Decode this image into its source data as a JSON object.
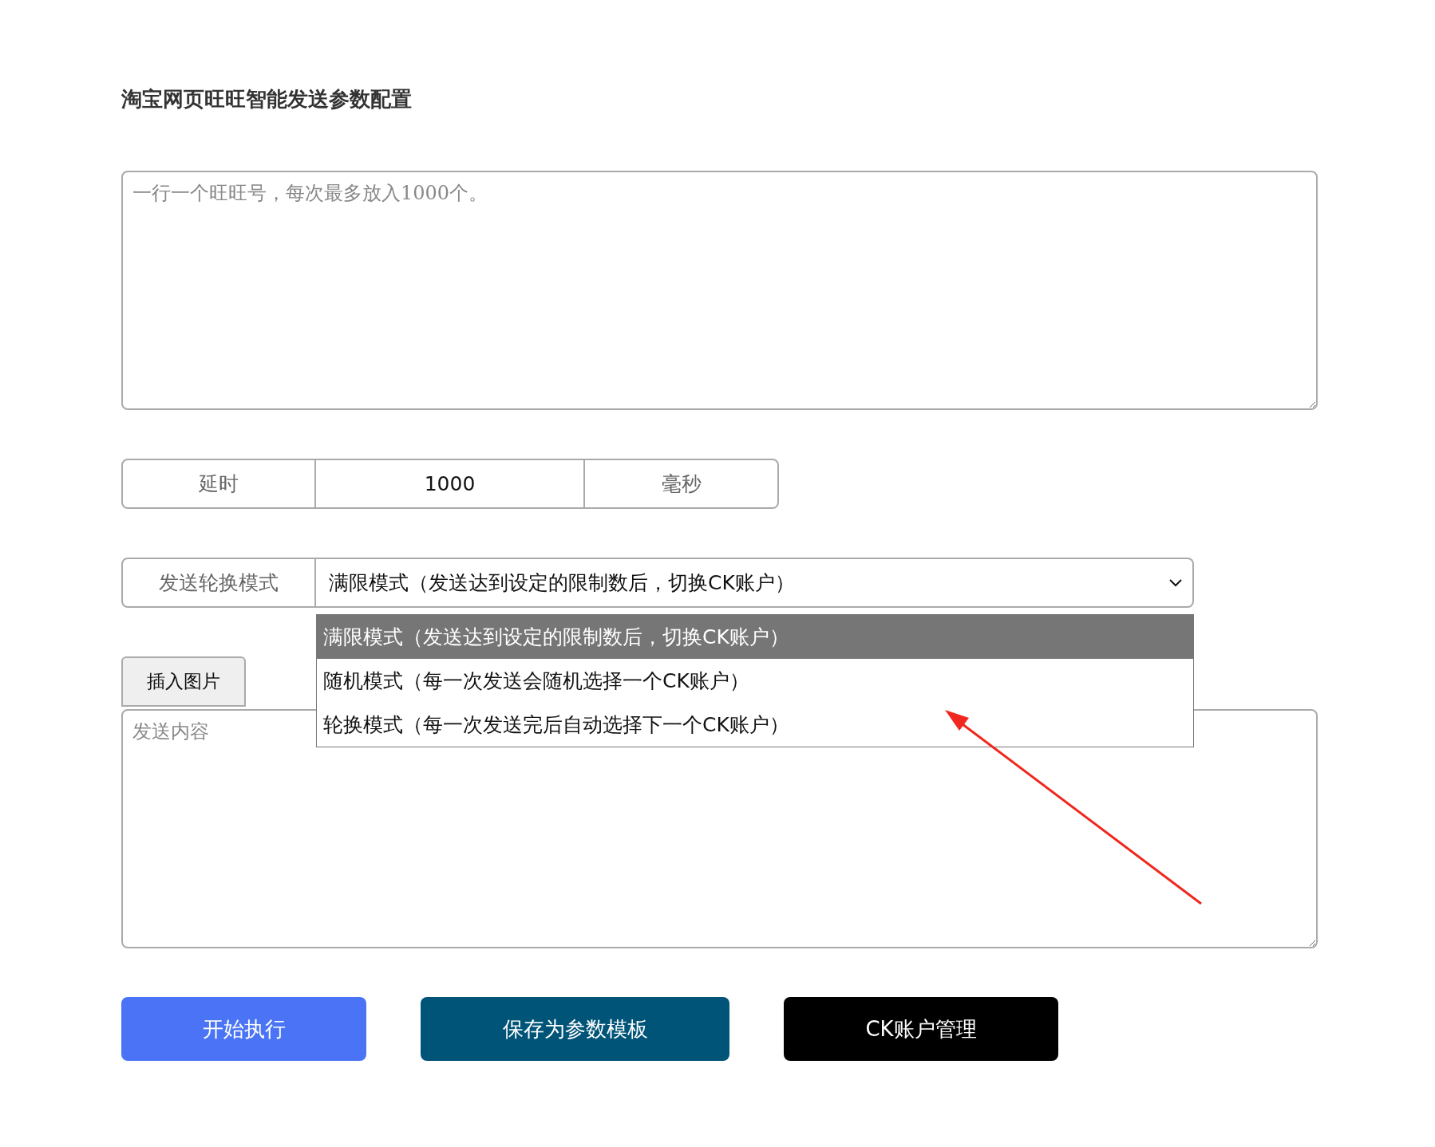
{
  "title": "淘宝网页旺旺智能发送参数配置",
  "accounts_field": {
    "placeholder": "一行一个旺旺号，每次最多放入1000个。"
  },
  "delay": {
    "label": "延时",
    "value": "1000",
    "unit": "毫秒"
  },
  "rotation_mode": {
    "label": "发送轮换模式",
    "value": "满限模式（发送达到设定的限制数后，切换CK账户）",
    "expanded": true,
    "options": [
      {
        "label": "满限模式（发送达到设定的限制数后，切换CK账户）",
        "selected": true
      },
      {
        "label": "随机模式（每一次发送会随机选择一个CK账户）",
        "selected": false
      },
      {
        "label": "轮换模式（每一次发送完后自动选择下一个CK账户）",
        "selected": false
      }
    ]
  },
  "insert_image_button": "插入图片",
  "content_field": {
    "placeholder": "发送内容"
  },
  "buttons": [
    {
      "label": "开始执行",
      "kind": "primary"
    },
    {
      "label": "保存为参数模板",
      "kind": "save"
    },
    {
      "label": "CK账户管理",
      "kind": "dark"
    }
  ]
}
